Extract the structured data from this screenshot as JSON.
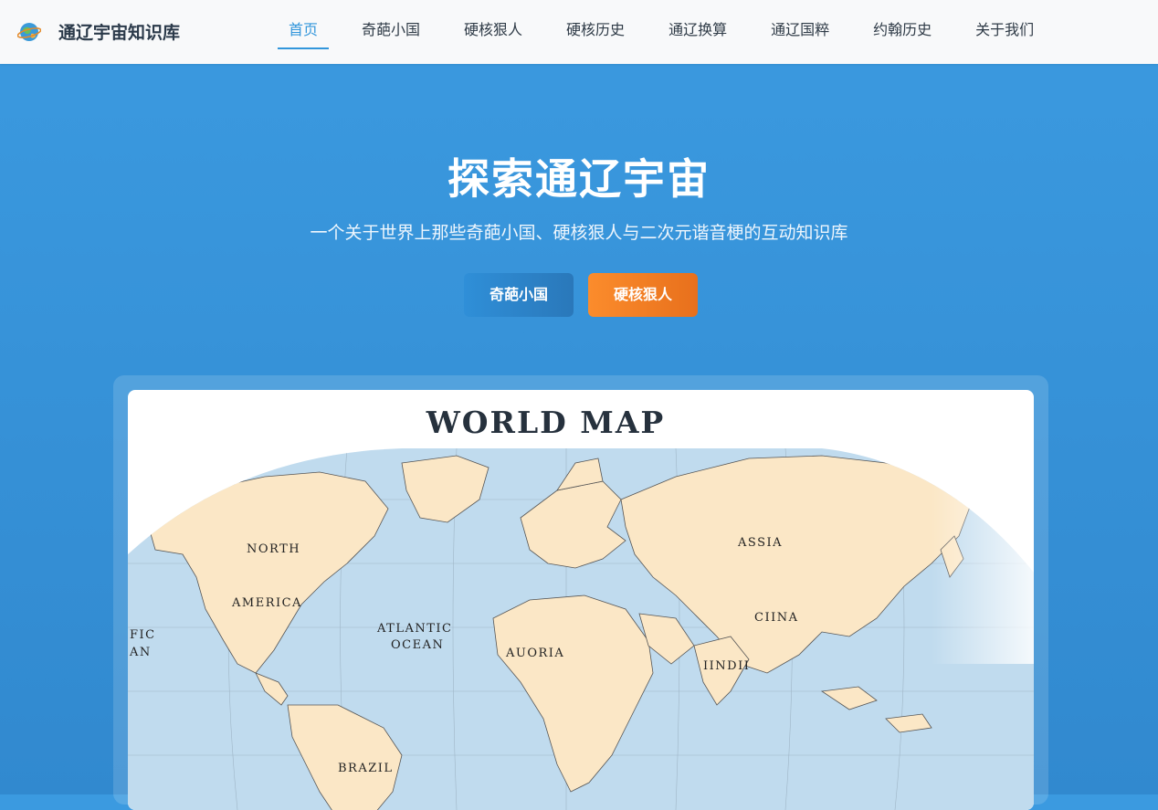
{
  "header": {
    "brand": "通辽宇宙知识库",
    "logo_icon": "planet-logo-icon",
    "nav": [
      {
        "label": "首页",
        "active": true
      },
      {
        "label": "奇葩小国",
        "active": false
      },
      {
        "label": "硬核狠人",
        "active": false
      },
      {
        "label": "硬核历史",
        "active": false
      },
      {
        "label": "通辽换算",
        "active": false
      },
      {
        "label": "通辽国粹",
        "active": false
      },
      {
        "label": "约翰历史",
        "active": false
      },
      {
        "label": "关于我们",
        "active": false
      }
    ]
  },
  "hero": {
    "title": "探索通辽宇宙",
    "subtitle": "一个关于世界上那些奇葩小国、硬核狠人与二次元谐音梗的互动知识库",
    "primary_button": "奇葩小国",
    "secondary_button": "硬核狠人"
  },
  "map": {
    "title": "WORLD MAP",
    "labels": {
      "north": "NORTH",
      "america": "AMERICA",
      "pacific_1": "FIC",
      "pacific_2": "AN",
      "atlantic_1": "ATLANTIC",
      "atlantic_2": "OCEAN",
      "africa": "AUORIA",
      "asia": "ASSIA",
      "china": "CIINA",
      "india": "IINDII",
      "brazil": "BRAZIL"
    }
  },
  "colors": {
    "accent": "#3296db",
    "orange": "#f5821f",
    "ocean": "#c0dbee",
    "land": "#fbe7c6"
  }
}
